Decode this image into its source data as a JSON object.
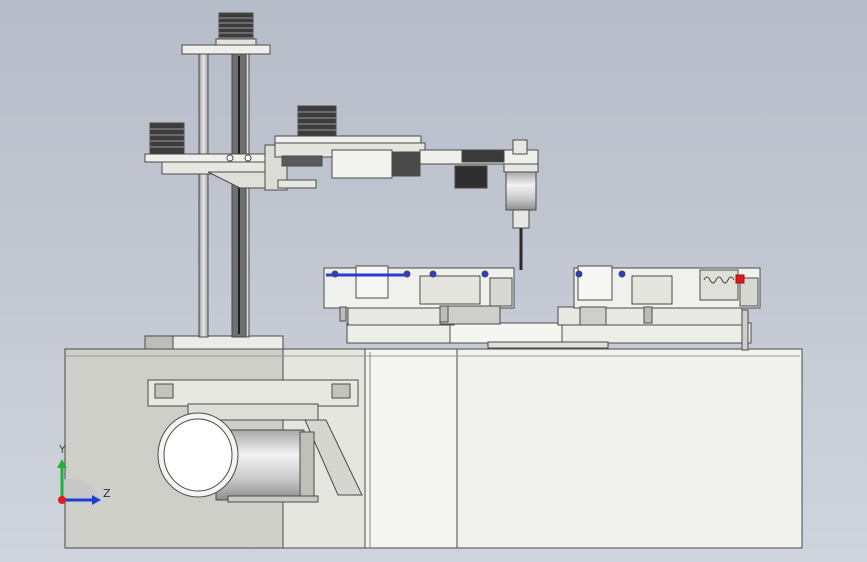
{
  "viewport": {
    "background_top": "#b6bcc8",
    "background_bottom": "#d0d4dc"
  },
  "triad": {
    "y_label": "Y",
    "z_label": "Z",
    "y_axis_color": "#22b03a",
    "z_axis_color": "#1a3fd6",
    "x_axis_color": "#e01c1c"
  },
  "colors": {
    "part_fill": "#efefeb",
    "part_stroke": "#4a4a4a",
    "motor_dark": "#3a3a3a",
    "accent_blue": "#2a3bd8",
    "accent_red": "#d81a1a"
  }
}
